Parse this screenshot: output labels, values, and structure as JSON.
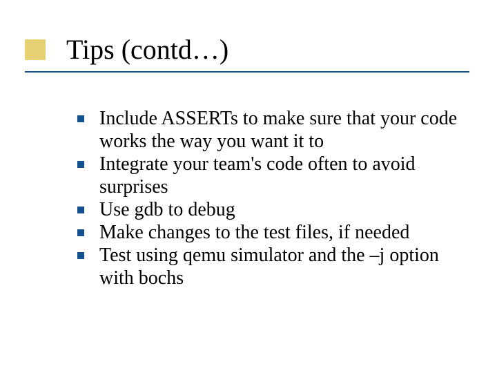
{
  "title": "Tips (contd…)",
  "bullets": [
    "Include ASSERTs to make sure that your code works the way you want it to",
    "Integrate your team's code often to avoid surprises",
    "Use gdb to debug",
    "Make changes to the test files, if needed",
    "Test using qemu simulator and the –j option with bochs"
  ]
}
